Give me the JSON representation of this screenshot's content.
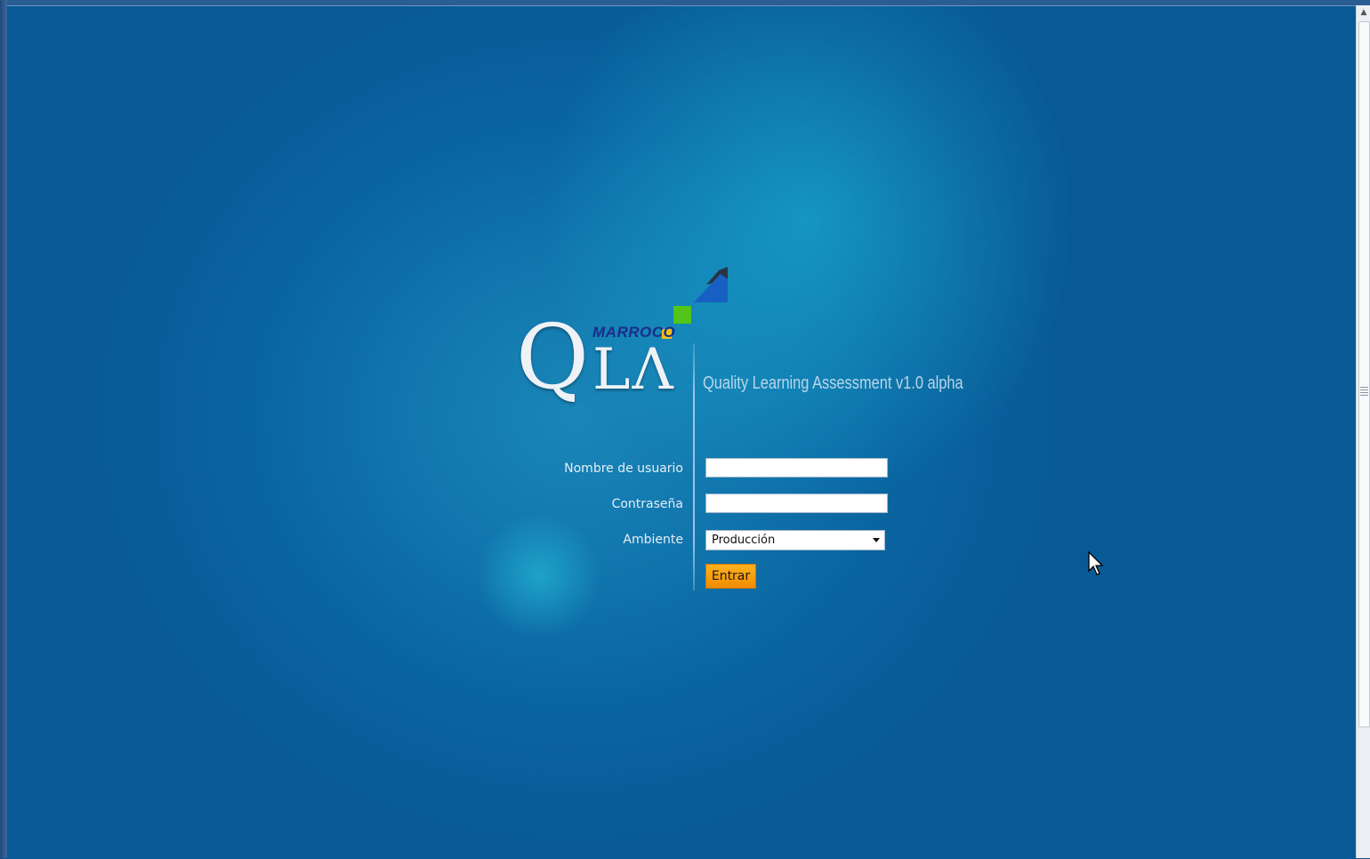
{
  "logo": {
    "brand": "MARROCO",
    "q": "Q",
    "la": "LΛ"
  },
  "app": {
    "subtitle": "Quality Learning Assessment v1.0 alpha"
  },
  "form": {
    "username_label": "Nombre de usuario",
    "username_value": "",
    "password_label": "Contraseña",
    "password_value": "",
    "environment_label": "Ambiente",
    "environment_selected": "Producción",
    "submit_label": "Entrar"
  },
  "colors": {
    "background": "#0a64a0",
    "button": "#f5a00e",
    "brand_text": "#1b2c8a"
  },
  "icons": {
    "cursor": "mouse-pointer-icon",
    "dropdown": "chevron-down-icon",
    "scroll_up": "scroll-up-arrow-icon"
  }
}
